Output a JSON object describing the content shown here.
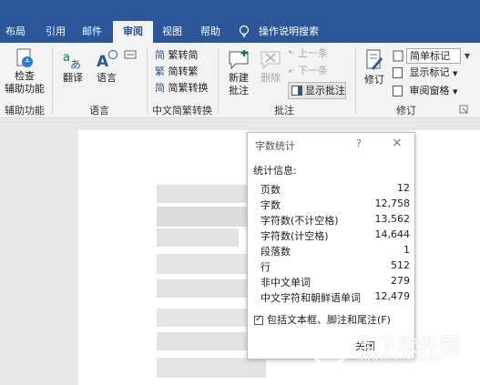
{
  "tabs": [
    {
      "label": "布局"
    },
    {
      "label": "引用"
    },
    {
      "label": "邮件"
    },
    {
      "label": "审阅"
    },
    {
      "label": "视图"
    },
    {
      "label": "帮助"
    }
  ],
  "tell_me": "操作说明搜索",
  "ribbon": {
    "accessibility": {
      "button": "检查\n辅助功能",
      "group": "辅助功能"
    },
    "language": {
      "translate": "翻译",
      "language": "语言",
      "group": "语言"
    },
    "chinese": {
      "to_simplified": "繁转简",
      "to_traditional": "简转繁",
      "convert": "简繁转换",
      "group": "中文简繁转换"
    },
    "comments": {
      "new": "新建\n批注",
      "delete": "删除",
      "previous": "上一条",
      "next": "下一条",
      "show": "显示批注",
      "group": "批注"
    },
    "tracking": {
      "track": "修订",
      "markup_value": "简单标记",
      "show_markup": "显示标记",
      "review_pane": "审阅窗格",
      "group": "修订"
    }
  },
  "dialog": {
    "title": "字数统计",
    "help": "?",
    "close_x": "×",
    "stats_label": "统计信息:",
    "stats": [
      {
        "name": "页数",
        "value": "12"
      },
      {
        "name": "字数",
        "value": "12,758"
      },
      {
        "name": "字符数(不计空格)",
        "value": "13,562"
      },
      {
        "name": "字符数(计空格)",
        "value": "14,644"
      },
      {
        "name": "段落数",
        "value": "1"
      },
      {
        "name": "行",
        "value": "512"
      },
      {
        "name": "非中文单词",
        "value": "279"
      },
      {
        "name": "中文字符和朝鲜语单词",
        "value": "12,479"
      }
    ],
    "include_label": "包括文本框、脚注和尾注(F)",
    "include_checked": true,
    "close_button": "关闭"
  },
  "watermark": {
    "name": "当下软件园",
    "url": "www.downxia.com"
  },
  "colors": {
    "accent": "#2b579a"
  }
}
